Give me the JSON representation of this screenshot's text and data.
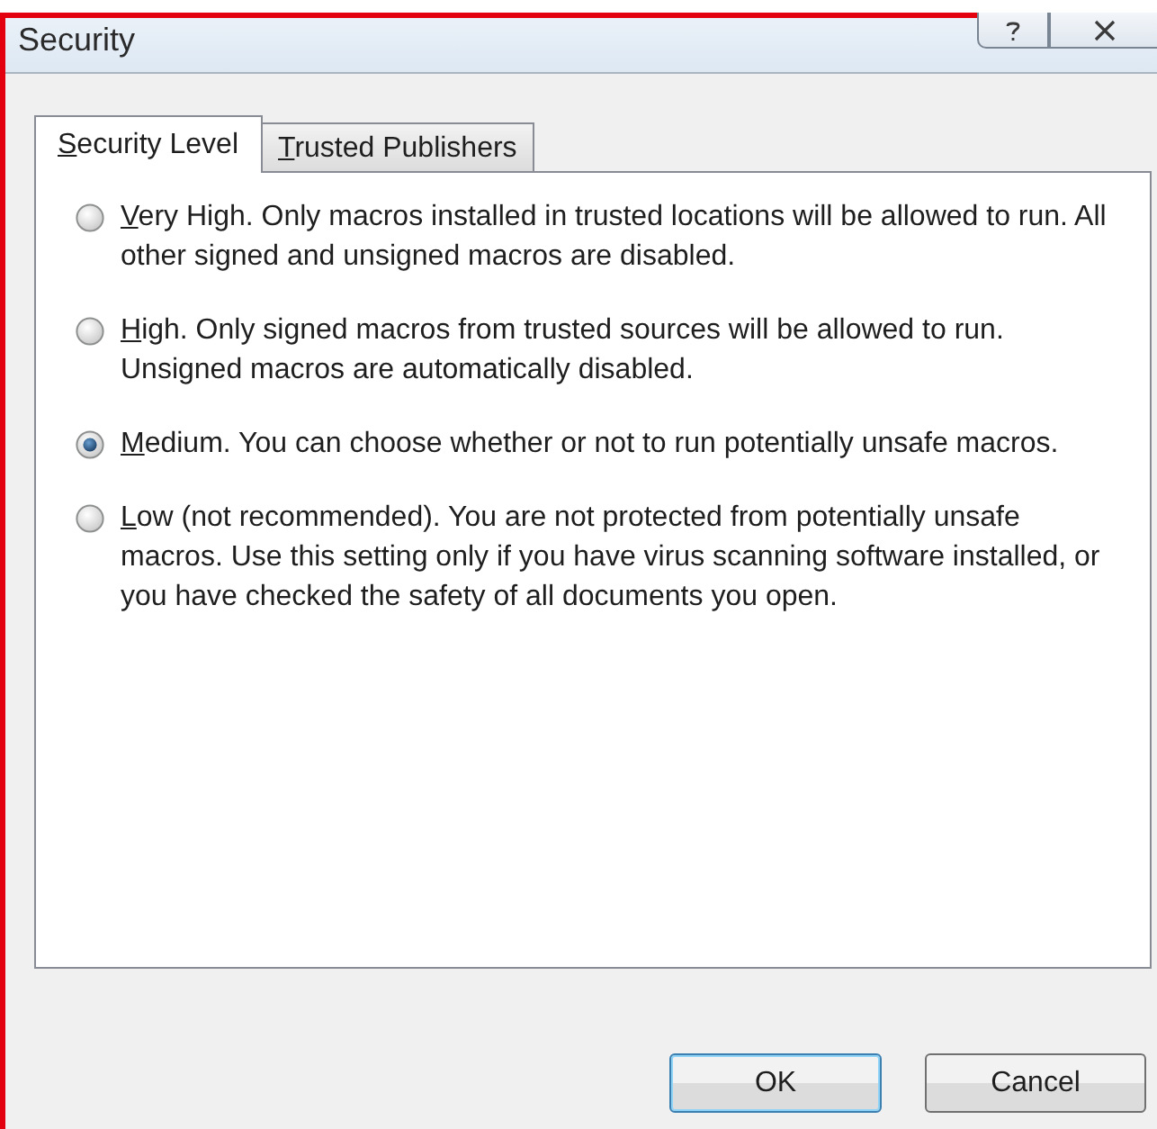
{
  "window": {
    "title": "Security"
  },
  "tabs": [
    {
      "label": "Security Level",
      "selected": true
    },
    {
      "label": "Trusted Publishers",
      "selected": false
    }
  ],
  "options": [
    {
      "label": "Very High. Only macros installed in trusted locations will be allowed to run. All other signed and unsigned macros are disabled.",
      "selected": false
    },
    {
      "label": "High. Only signed macros from trusted sources will be allowed to run. Unsigned macros are automatically disabled.",
      "selected": false
    },
    {
      "label": "Medium. You can choose whether or not to run potentially unsafe macros.",
      "selected": true
    },
    {
      "label": "Low (not recommended). You are not protected from potentially unsafe macros. Use this setting only if you have virus scanning software installed, or you have checked the safety of all documents you open.",
      "selected": false
    }
  ],
  "buttons": [
    {
      "label": "OK",
      "kind": "default"
    },
    {
      "label": "Cancel",
      "kind": "normal"
    }
  ]
}
